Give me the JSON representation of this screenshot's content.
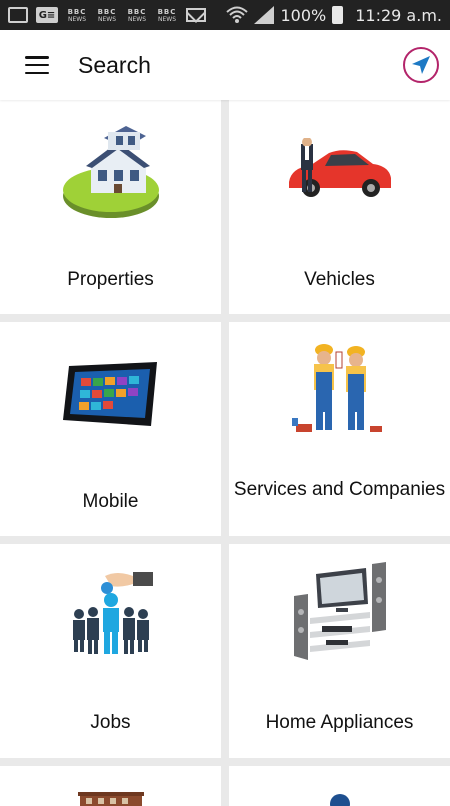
{
  "status_bar": {
    "battery": "100%",
    "time": "11:29 a.m.",
    "notification_icons": [
      "gallery-icon",
      "google-translate-icon",
      "bbc-news-icon",
      "bbc-news-icon",
      "bbc-news-icon",
      "bbc-news-icon",
      "mail-icon"
    ],
    "bbc_text": "BBC",
    "news_text": "NEWS",
    "ge_text": "G≡"
  },
  "app_bar": {
    "title": "Search",
    "menu_icon": "hamburger-menu-icon",
    "location_icon": "navigation-arrow-icon",
    "accent": "#b3246a",
    "arrow_color": "#1d79c4"
  },
  "categories": [
    {
      "label": "Properties",
      "icon": "house-icon"
    },
    {
      "label": "Vehicles",
      "icon": "car-icon"
    },
    {
      "label": "Mobile",
      "icon": "tablet-icon"
    },
    {
      "label": "Services and Companies",
      "icon": "workers-icon"
    },
    {
      "label": "Jobs",
      "icon": "job-seekers-icon"
    },
    {
      "label": "Home Appliances",
      "icon": "home-theater-icon"
    },
    {
      "label": "",
      "icon": "building-icon"
    },
    {
      "label": "",
      "icon": "person-icon"
    }
  ]
}
